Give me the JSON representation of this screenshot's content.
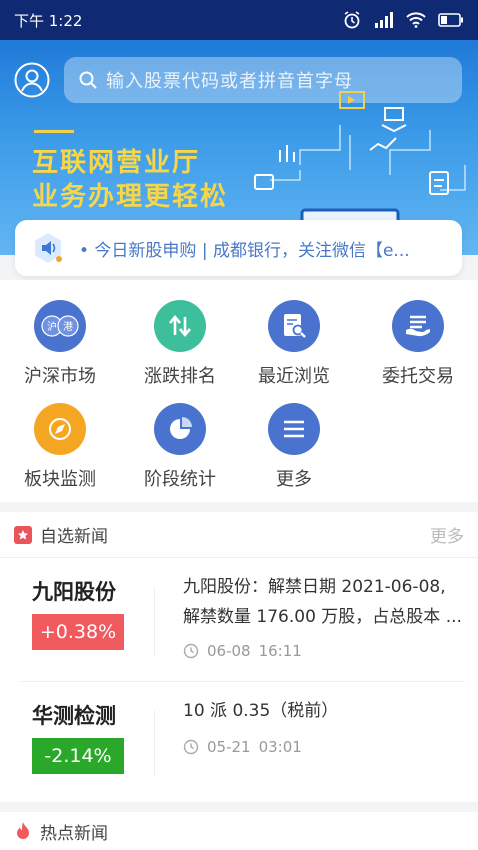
{
  "status": {
    "time": "下午 1:22"
  },
  "search": {
    "placeholder": "输入股票代码或者拼音首字母"
  },
  "banner": {
    "title_line1": "互联网营业厅",
    "title_line2": "业务办理更轻松"
  },
  "notice": {
    "text": "• 今日新股申购 | 成都银行，关注微信【e..."
  },
  "grid": {
    "items": [
      {
        "label": "沪深市场",
        "icon": "hushen-market-icon",
        "color": "#4a73cf"
      },
      {
        "label": "涨跌排名",
        "icon": "rise-fall-rank-icon",
        "color": "#3dbf9c"
      },
      {
        "label": "最近浏览",
        "icon": "recent-browse-icon",
        "color": "#4a73cf"
      },
      {
        "label": "委托交易",
        "icon": "entrust-trade-icon",
        "color": "#4a73cf"
      },
      {
        "label": "板块监测",
        "icon": "sector-monitor-icon",
        "color": "#f5a623"
      },
      {
        "label": "阶段统计",
        "icon": "stage-stats-icon",
        "color": "#4a73cf"
      },
      {
        "label": "更多",
        "icon": "more-icon",
        "color": "#4a73cf"
      }
    ],
    "badge_hu": "沪",
    "badge_gang": "港"
  },
  "news": {
    "title": "自选新闻",
    "more": "更多",
    "items": [
      {
        "name": "九阳股份",
        "change": "+0.38%",
        "change_color": "#f0595e",
        "content": "九阳股份：解禁日期 2021-06-08, 解禁数量 176.00 万股，占总股本 ...",
        "date": "06-08",
        "time": "16:11"
      },
      {
        "name": "华测检测",
        "change": "-2.14%",
        "change_color": "#2aa82a",
        "content": "10 派 0.35（税前）",
        "date": "05-21",
        "time": "03:01"
      }
    ]
  },
  "hot": {
    "title": "热点新闻"
  },
  "colors": {
    "status_bar": "#0f2a73",
    "accent": "#4a73cf",
    "up": "#f0595e",
    "down": "#2aa82a"
  }
}
